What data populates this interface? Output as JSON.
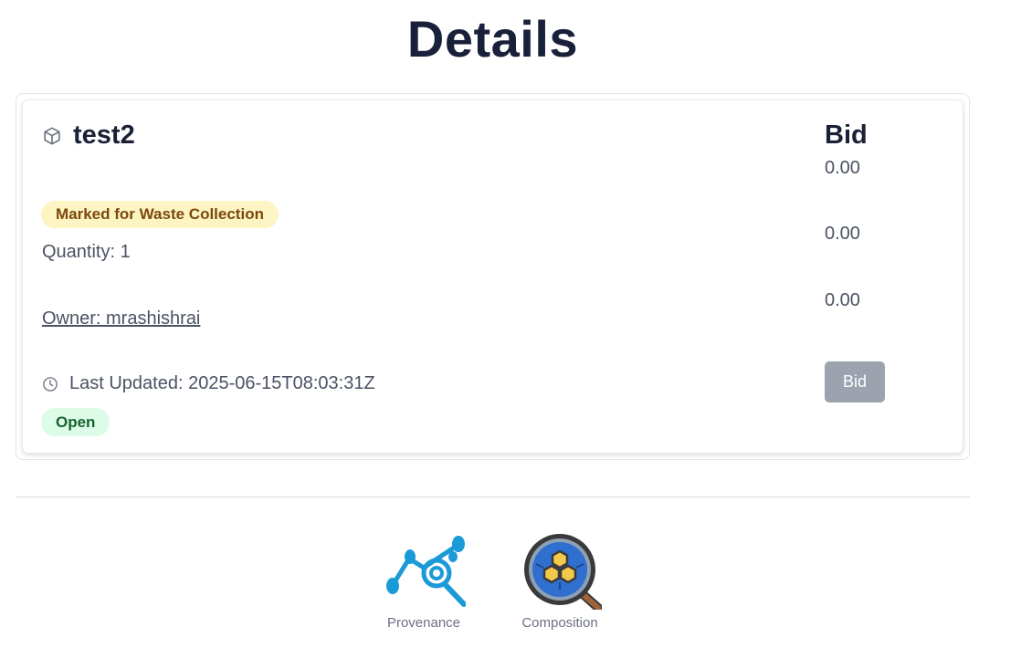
{
  "page": {
    "title": "Details"
  },
  "item": {
    "name": "test2",
    "status_badge": "Marked for Waste Collection",
    "quantity": "Quantity: 1",
    "owner": "Owner: mrashishrai",
    "last_updated": "Last Updated: 2025-06-15T08:03:31Z",
    "state_badge": "Open"
  },
  "bid": {
    "heading": "Bid",
    "values": [
      "0.00",
      "0.00",
      "0.00"
    ],
    "button_label": "Bid"
  },
  "tools": [
    {
      "label": "Provenance",
      "icon": "provenance-icon"
    },
    {
      "label": "Composition",
      "icon": "composition-icon"
    }
  ],
  "colors": {
    "title": "#19203a",
    "waste_badge_bg": "#fdf4c4",
    "waste_badge_text": "#7a4a0c",
    "open_badge_bg": "#dcfce7",
    "open_badge_text": "#17622f",
    "disabled_button": "#9ca3af",
    "provenance_blue": "#1b9ad8",
    "composition_blue": "#2f6fd0",
    "composition_yellow": "#f3c94a"
  }
}
